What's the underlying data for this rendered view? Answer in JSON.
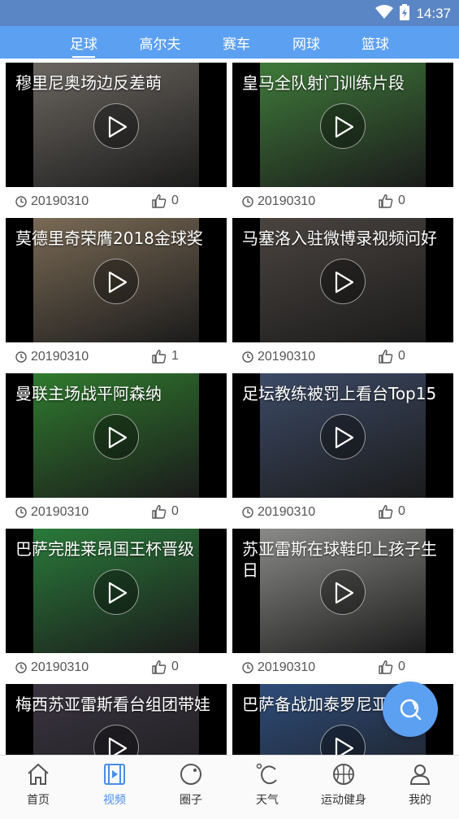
{
  "status_bar": {
    "time": "14:37"
  },
  "tabs": [
    {
      "label": "足球",
      "active": true
    },
    {
      "label": "高尔夫",
      "active": false
    },
    {
      "label": "赛车",
      "active": false
    },
    {
      "label": "网球",
      "active": false
    },
    {
      "label": "篮球",
      "active": false
    }
  ],
  "videos": [
    {
      "title": "穆里尼奥场边反差萌",
      "date": "20190310",
      "likes": "0"
    },
    {
      "title": "皇马全队射门训练片段",
      "date": "20190310",
      "likes": "0"
    },
    {
      "title": "莫德里奇荣膺2018金球奖",
      "date": "20190310",
      "likes": "1"
    },
    {
      "title": "马塞洛入驻微博录视频问好",
      "date": "20190310",
      "likes": "0"
    },
    {
      "title": "曼联主场战平阿森纳",
      "date": "20190310",
      "likes": "0"
    },
    {
      "title": "足坛教练被罚上看台Top15",
      "date": "20190310",
      "likes": "0"
    },
    {
      "title": "巴萨完胜莱昂国王杯晋级",
      "date": "20190310",
      "likes": "0"
    },
    {
      "title": "苏亚雷斯在球鞋印上孩子生日",
      "date": "20190310",
      "likes": "0"
    },
    {
      "title": "梅西苏亚雷斯看台组团带娃",
      "date": "",
      "likes": ""
    },
    {
      "title": "巴萨备战加泰罗尼亚杯",
      "date": "",
      "likes": ""
    }
  ],
  "thumb_colors": [
    "#6b6660",
    "#3f7a3a",
    "#7a6a55",
    "#4a4440",
    "#2f7a2e",
    "#3c4a66",
    "#2a7a3a",
    "#8a8a88",
    "#3a3440",
    "#2e4c7a"
  ],
  "bottom_nav": [
    {
      "label": "首页",
      "icon": "home-icon",
      "active": false
    },
    {
      "label": "视频",
      "icon": "video-icon",
      "active": true
    },
    {
      "label": "圈子",
      "icon": "circle-icon",
      "active": false
    },
    {
      "label": "天气",
      "icon": "weather-icon",
      "active": false
    },
    {
      "label": "运动健身",
      "icon": "basketball-icon",
      "active": false
    },
    {
      "label": "我的",
      "icon": "profile-icon",
      "active": false
    }
  ],
  "colors": {
    "status_bar": "#5b86c6",
    "tab_bar": "#5ca0f2",
    "active_nav": "#4a8de8",
    "fab": "#5ca0f2"
  }
}
